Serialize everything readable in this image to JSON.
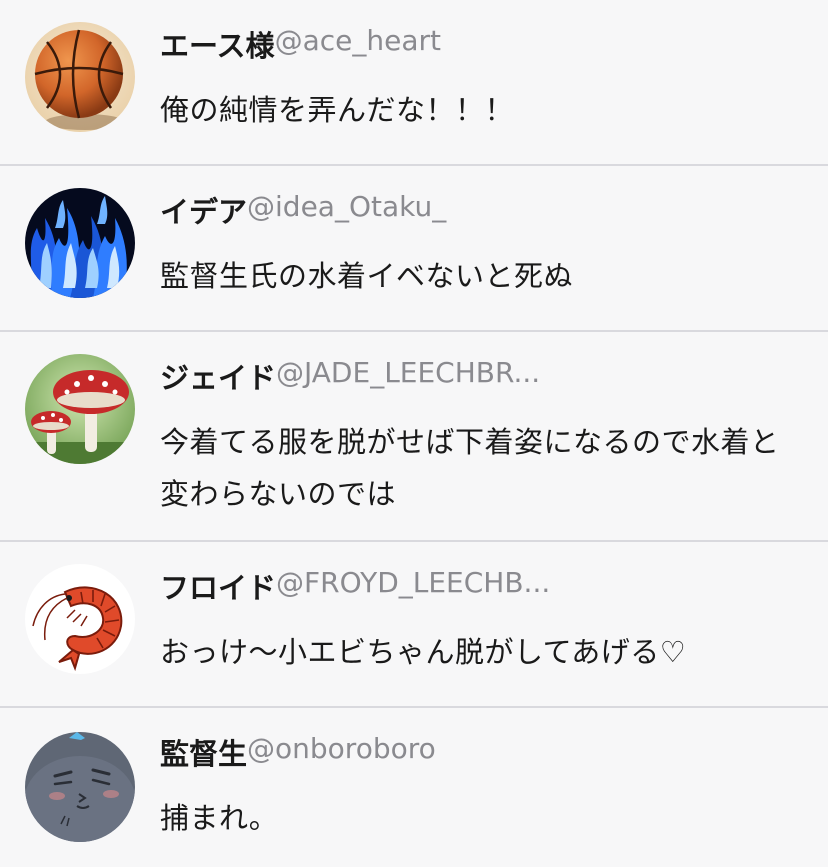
{
  "tweets": [
    {
      "display_name": "エース様",
      "handle": "@ace_heart",
      "message": "俺の純情を弄んだな！！！",
      "avatar_icon": "basketball-icon"
    },
    {
      "display_name": "イデア",
      "handle": "@idea_Otaku_",
      "message": "監督生氏の水着イベないと死ぬ",
      "avatar_icon": "blue-flame-icon"
    },
    {
      "display_name": "ジェイド",
      "handle": "@JADE_LEECHBR...",
      "message": "今着てる服を脱がせば下着姿になるので水着と変わらないのでは",
      "avatar_icon": "mushroom-icon"
    },
    {
      "display_name": "フロイド",
      "handle": "@FROYD_LEECHB...",
      "message": "おっけ〜小エビちゃん脱がしてあげる♡",
      "avatar_icon": "shrimp-icon"
    },
    {
      "display_name": "監督生",
      "handle": "@onboroboro",
      "message": "捕まれ。",
      "avatar_icon": "grey-cat-icon"
    }
  ],
  "colors": {
    "background": "#f7f7f8",
    "divider": "#d9d9de",
    "name_text": "#1a1a1a",
    "handle_text": "#8a8a8f"
  }
}
